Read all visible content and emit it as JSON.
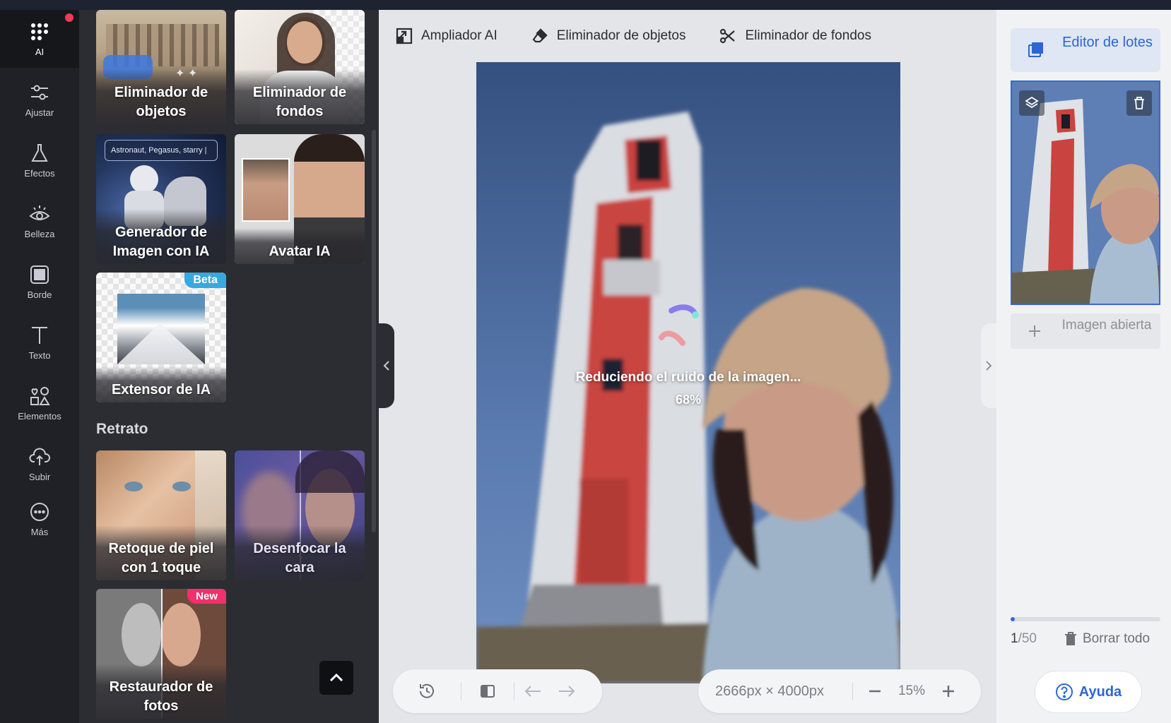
{
  "rail": {
    "items": [
      {
        "label": "AI",
        "icon": "ai-grid-icon"
      },
      {
        "label": "Ajustar",
        "icon": "sliders-icon"
      },
      {
        "label": "Efectos",
        "icon": "flask-icon"
      },
      {
        "label": "Belleza",
        "icon": "eye-icon"
      },
      {
        "label": "Borde",
        "icon": "frame-icon"
      },
      {
        "label": "Texto",
        "icon": "text-icon"
      },
      {
        "label": "Elementos",
        "icon": "shapes-icon"
      },
      {
        "label": "Subir",
        "icon": "upload-cloud-icon"
      },
      {
        "label": "Más",
        "icon": "more-icon"
      }
    ]
  },
  "panel": {
    "cards": [
      {
        "label": "Eliminador de objetos"
      },
      {
        "label": "Eliminador de fondos"
      },
      {
        "label": "Generador de Imagen con IA",
        "prompt_text": "Astronaut, Pegasus, starry |"
      },
      {
        "label": "Avatar IA"
      },
      {
        "label": "Extensor de IA",
        "badge": "Beta"
      },
      {
        "label": "Retoque de piel con 1 toque"
      },
      {
        "label": "Desenfocar la cara"
      },
      {
        "label": "Restaurador de fotos",
        "badge": "New"
      }
    ],
    "section_retrato": "Retrato"
  },
  "toolbar": {
    "upscaler": "Ampliador AI",
    "object_remover": "Eliminador de objetos",
    "bg_remover": "Eliminador de fondos"
  },
  "canvas": {
    "status": "Reduciendo el ruido de la imagen...",
    "progress": "68%"
  },
  "bottom": {
    "dimensions": "2666px × 4000px",
    "zoom": "15%"
  },
  "right": {
    "batch_editor": "Editor de lotes",
    "open_image": "Imagen abierta",
    "count_current": "1",
    "count_total": "/50",
    "clear_all": "Borrar todo",
    "help": "Ayuda"
  },
  "colors": {
    "accent": "#2d66d6",
    "beta_badge": "#37a8e0",
    "new_badge": "#f0316b",
    "notify_dot": "#ef3b56"
  }
}
